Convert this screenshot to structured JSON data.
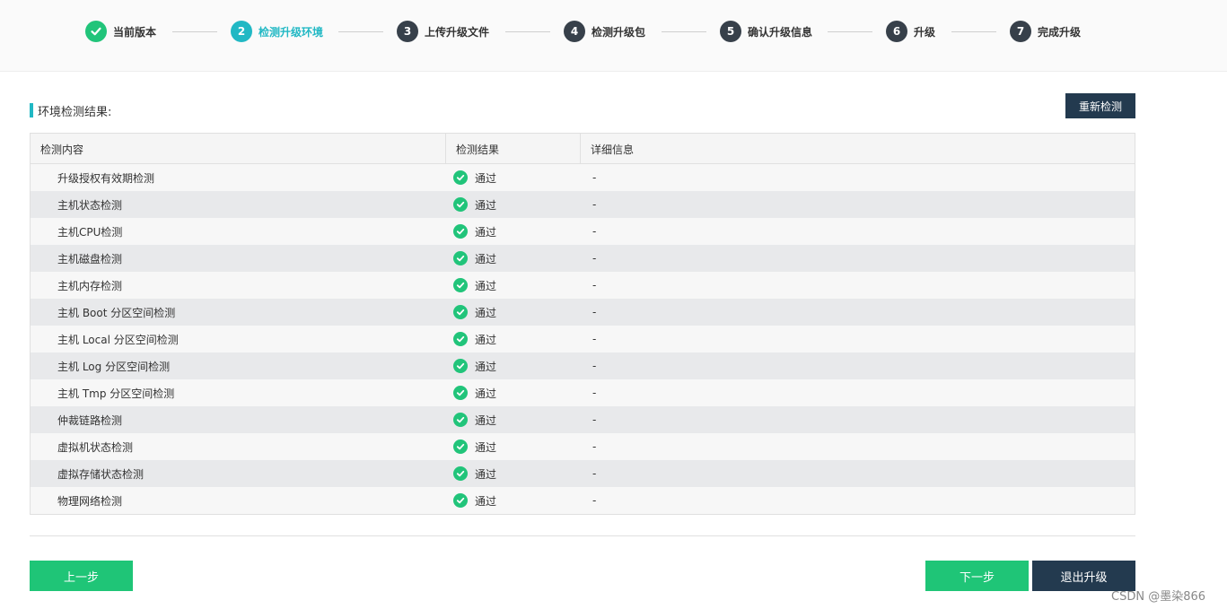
{
  "stepper": {
    "steps": [
      {
        "number": "",
        "label": "当前版本",
        "state": "done"
      },
      {
        "number": "2",
        "label": "检测升级环境",
        "state": "active"
      },
      {
        "number": "3",
        "label": "上传升级文件",
        "state": "todo"
      },
      {
        "number": "4",
        "label": "检测升级包",
        "state": "todo"
      },
      {
        "number": "5",
        "label": "确认升级信息",
        "state": "todo"
      },
      {
        "number": "6",
        "label": "升级",
        "state": "todo"
      },
      {
        "number": "7",
        "label": "完成升级",
        "state": "todo"
      }
    ]
  },
  "section": {
    "title": "环境检测结果:",
    "recheck_label": "重新检测"
  },
  "table": {
    "headers": [
      "检测内容",
      "检测结果",
      "详细信息"
    ],
    "rows": [
      {
        "item": "升级授权有效期检测",
        "result": "通过",
        "detail": "-"
      },
      {
        "item": "主机状态检测",
        "result": "通过",
        "detail": "-"
      },
      {
        "item": "主机CPU检测",
        "result": "通过",
        "detail": "-"
      },
      {
        "item": "主机磁盘检测",
        "result": "通过",
        "detail": "-"
      },
      {
        "item": "主机内存检测",
        "result": "通过",
        "detail": "-"
      },
      {
        "item": "主机 Boot 分区空间检测",
        "result": "通过",
        "detail": "-"
      },
      {
        "item": "主机 Local 分区空间检测",
        "result": "通过",
        "detail": "-"
      },
      {
        "item": "主机 Log 分区空间检测",
        "result": "通过",
        "detail": "-"
      },
      {
        "item": "主机 Tmp 分区空间检测",
        "result": "通过",
        "detail": "-"
      },
      {
        "item": "仲裁链路检测",
        "result": "通过",
        "detail": "-"
      },
      {
        "item": "虚拟机状态检测",
        "result": "通过",
        "detail": "-"
      },
      {
        "item": "虚拟存储状态检测",
        "result": "通过",
        "detail": "-"
      },
      {
        "item": "物理网络检测",
        "result": "通过",
        "detail": "-"
      }
    ]
  },
  "footer": {
    "prev_label": "上一步",
    "next_label": "下一步",
    "exit_label": "退出升级"
  },
  "watermark": "CSDN @墨染866",
  "colors": {
    "success": "#21c47a",
    "active": "#21b8c4",
    "dark": "#233a4f",
    "step_todo": "#37404a"
  }
}
